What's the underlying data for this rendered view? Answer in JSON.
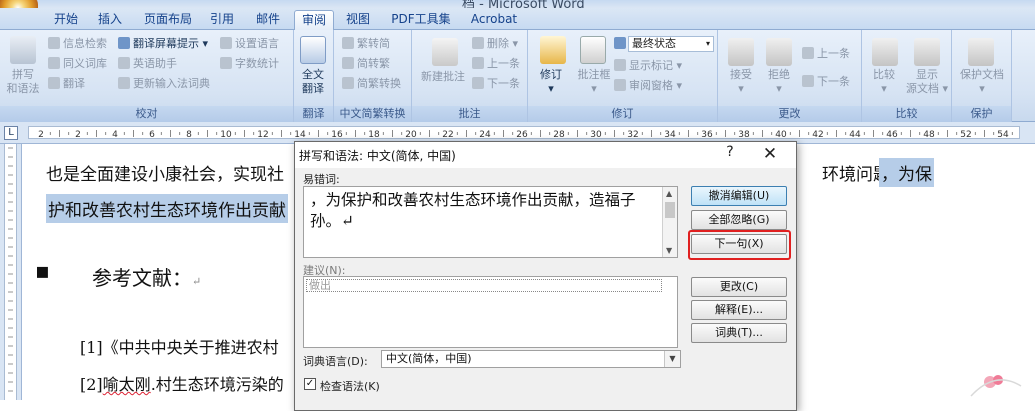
{
  "window": {
    "title": "档 - Microsoft Word"
  },
  "tabs": [
    {
      "label": "开始"
    },
    {
      "label": "插入"
    },
    {
      "label": "页面布局"
    },
    {
      "label": "引用"
    },
    {
      "label": "邮件"
    },
    {
      "label": "审阅"
    },
    {
      "label": "视图"
    },
    {
      "label": "PDF工具集"
    },
    {
      "label": "Acrobat"
    }
  ],
  "ribbon": {
    "proofing": {
      "label": "校对",
      "spell_grammar": "拼写\n和语法",
      "info_search": "信息检索",
      "translate_tip": "翻译屏幕提示",
      "set_language": "设置语言",
      "thesaurus": "同义词库",
      "english_assistant": "英语助手",
      "word_count": "字数统计",
      "translate": "翻译",
      "update_ime": "更新输入法词典"
    },
    "translate_group": {
      "label": "翻译",
      "full_translate_1": "全文",
      "full_translate_2": "翻译"
    },
    "chinese_convert": {
      "label": "中文简繁转换",
      "to_traditional": "繁转简",
      "to_simplified": "简转繁",
      "convert": "简繁转换"
    },
    "comments": {
      "label": "批注",
      "new_comment": "新建批注",
      "delete": "删除",
      "previous": "上一条",
      "next": "下一条"
    },
    "tracking": {
      "label": "修订",
      "track": "修订",
      "balloons": "批注框",
      "final_state": "最终状态",
      "show_markup": "显示标记",
      "review_pane": "审阅窗格"
    },
    "changes": {
      "label": "更改",
      "accept": "接受",
      "reject": "拒绝",
      "previous": "上一条",
      "next": "下一条"
    },
    "compare": {
      "label": "比较",
      "compare": "比较",
      "show_source_1": "显示",
      "show_source_2": "源文档"
    },
    "protect": {
      "label": "保护",
      "protect_doc": "保护文档"
    }
  },
  "ruler": {
    "ticks": [
      "2",
      "2",
      "4",
      "6",
      "8",
      "10",
      "12",
      "14",
      "16",
      "18",
      "20",
      "22",
      "24",
      "26",
      "28",
      "30",
      "32",
      "34",
      "36",
      "38",
      "40",
      "42",
      "44",
      "46",
      "48",
      "52",
      "54"
    ]
  },
  "document": {
    "line1_a": "也是全面建设小康社会，实现社",
    "line1_b": "环境问题。",
    "line1_c": "，为保",
    "line2": "护和改善农村生态环境作出贡献",
    "line2_wavy": "作出",
    "heading": "参考文献：",
    "ref1": "[1]《中共中央关于推进农村",
    "ref2_a": "[2]",
    "ref2_b": "喻太刚",
    "ref2_c": ".村生态环境污染的",
    "para_mark": "↵"
  },
  "dialog": {
    "title": "拼写和语法: 中文(简体, 中国)",
    "help": "?",
    "close": "✕",
    "error_label": "易错词:",
    "error_text": "，为保护和改善农村生态环境作出贡献，造福子孙。↵",
    "suggestion_label": "建议(N):",
    "suggestion_item": "做出",
    "buttons": {
      "undo_edit": "撤消编辑(U)",
      "ignore_all": "全部忽略(G)",
      "next_sentence": "下一句(X)",
      "change": "更改(C)",
      "explain": "解释(E)...",
      "dictionary": "词典(T)..."
    },
    "dict_language_label": "词典语言(D):",
    "dict_language_value": "中文(简体，中国)",
    "check_grammar_label": "检查语法(K)",
    "check_grammar_checked": true
  },
  "colors": {
    "ribbon_bg": "#d6e3f3",
    "highlight_box": "#e02020",
    "selection": "#b6cde8"
  }
}
